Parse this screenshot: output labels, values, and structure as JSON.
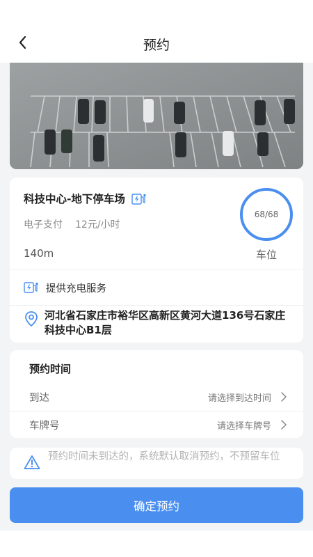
{
  "header": {
    "title": "预约",
    "back_icon": "chevron-left-icon"
  },
  "photo": {
    "description_icon": "parking-lot-photo"
  },
  "lot": {
    "name": "科技中心-地下停车场",
    "payment": "电子支付",
    "price": "12元/小时",
    "distance": "140m",
    "spots": "68/68",
    "spots_label": "车位",
    "service": "提供充电服务",
    "address": "河北省石家庄市裕华区高新区黄河大道136号石家庄科技中心B1层",
    "charge_icon": "charging-station-icon",
    "location_icon": "location-pin-icon"
  },
  "reservation": {
    "title": "预约时间",
    "arrive_label": "到达",
    "arrive_placeholder": "请选择到达时间",
    "plate_label": "车牌号",
    "plate_placeholder": "请选择车牌号"
  },
  "notice": {
    "text": "预约时间未到达的，系统默认取消预约，不预留车位",
    "icon": "warning-icon"
  },
  "confirm_label": "确定预约",
  "colors": {
    "accent": "#4a8ff0",
    "background": "#f3f4f6"
  }
}
